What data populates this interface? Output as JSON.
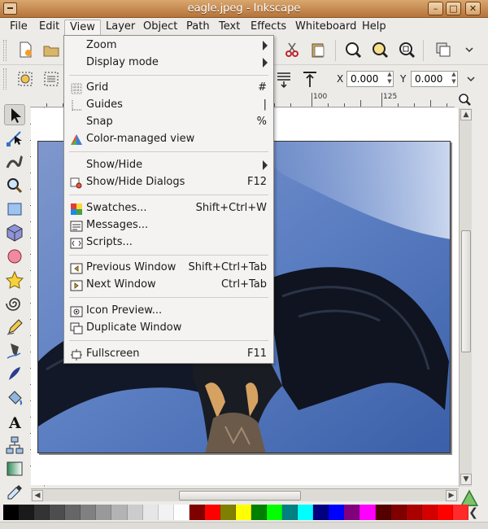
{
  "window": {
    "title": "eagle.jpeg - Inkscape"
  },
  "window_buttons": [
    "minimize-button",
    "maximize-button",
    "close-button"
  ],
  "menubar": [
    {
      "label": "File",
      "name": "menu-file"
    },
    {
      "label": "Edit",
      "name": "menu-edit"
    },
    {
      "label": "View",
      "name": "menu-view"
    },
    {
      "label": "Layer",
      "name": "menu-layer"
    },
    {
      "label": "Object",
      "name": "menu-object"
    },
    {
      "label": "Path",
      "name": "menu-path"
    },
    {
      "label": "Text",
      "name": "menu-text"
    },
    {
      "label": "Effects",
      "name": "menu-effects"
    },
    {
      "label": "Whiteboard",
      "name": "menu-whiteboard"
    },
    {
      "label": "Help",
      "name": "menu-help"
    }
  ],
  "view_menu": [
    {
      "label": "Zoom",
      "shortcut": "",
      "submenu": true,
      "icon": "none"
    },
    {
      "label": "Display mode",
      "shortcut": "",
      "submenu": true,
      "icon": "none"
    },
    {
      "label": "Grid",
      "shortcut": "#",
      "submenu": false,
      "icon": "grid-icon"
    },
    {
      "label": "Guides",
      "shortcut": "|",
      "submenu": false,
      "icon": "guides-icon"
    },
    {
      "label": "Snap",
      "shortcut": "%",
      "submenu": false,
      "icon": "none"
    },
    {
      "label": "Color-managed view",
      "shortcut": "",
      "submenu": false,
      "icon": "color-managed-icon"
    },
    {
      "label": "Show/Hide",
      "shortcut": "",
      "submenu": true,
      "icon": "none"
    },
    {
      "label": "Show/Hide Dialogs",
      "shortcut": "F12",
      "submenu": false,
      "icon": "dialogs-icon"
    },
    {
      "label": "Swatches...",
      "shortcut": "Shift+Ctrl+W",
      "submenu": false,
      "icon": "swatches-icon"
    },
    {
      "label": "Messages...",
      "shortcut": "",
      "submenu": false,
      "icon": "messages-icon"
    },
    {
      "label": "Scripts...",
      "shortcut": "",
      "submenu": false,
      "icon": "scripts-icon"
    },
    {
      "label": "Previous Window",
      "shortcut": "Shift+Ctrl+Tab",
      "submenu": false,
      "icon": "previous-window-icon"
    },
    {
      "label": "Next Window",
      "shortcut": "Ctrl+Tab",
      "submenu": false,
      "icon": "next-window-icon"
    },
    {
      "label": "Icon Preview...",
      "shortcut": "",
      "submenu": false,
      "icon": "icon-preview-icon"
    },
    {
      "label": "Duplicate Window",
      "shortcut": "",
      "submenu": false,
      "icon": "duplicate-window-icon"
    },
    {
      "label": "Fullscreen",
      "shortcut": "F11",
      "submenu": false,
      "icon": "fullscreen-icon"
    }
  ],
  "toolbar": {
    "x_label": "X",
    "x_value": "0.000",
    "y_label": "Y",
    "y_value": "0.000"
  },
  "ruler": {
    "h_labels": [
      "100",
      "125"
    ]
  },
  "tools": [
    "selector-tool",
    "node-tool",
    "tweak-tool",
    "zoom-tool",
    "rectangle-tool",
    "3d-box-tool",
    "ellipse-tool",
    "star-tool",
    "spiral-tool",
    "pencil-tool",
    "pen-tool",
    "calligraphy-tool",
    "paint-bucket-tool",
    "text-tool",
    "connector-tool",
    "gradient-tool",
    "dropper-tool"
  ],
  "palette": [
    "#000000",
    "#1a1a1a",
    "#333333",
    "#4d4d4d",
    "#666666",
    "#808080",
    "#999999",
    "#b3b3b3",
    "#cccccc",
    "#e6e6e6",
    "#f2f2f2",
    "#ffffff",
    "#800000",
    "#ff0000",
    "#808000",
    "#ffff00",
    "#008000",
    "#00ff00",
    "#008080",
    "#00ffff",
    "#000080",
    "#0000ff",
    "#800080",
    "#ff00ff",
    "#550000",
    "#800000",
    "#aa0000",
    "#d40000",
    "#ff0000",
    "#ff2a2a"
  ]
}
